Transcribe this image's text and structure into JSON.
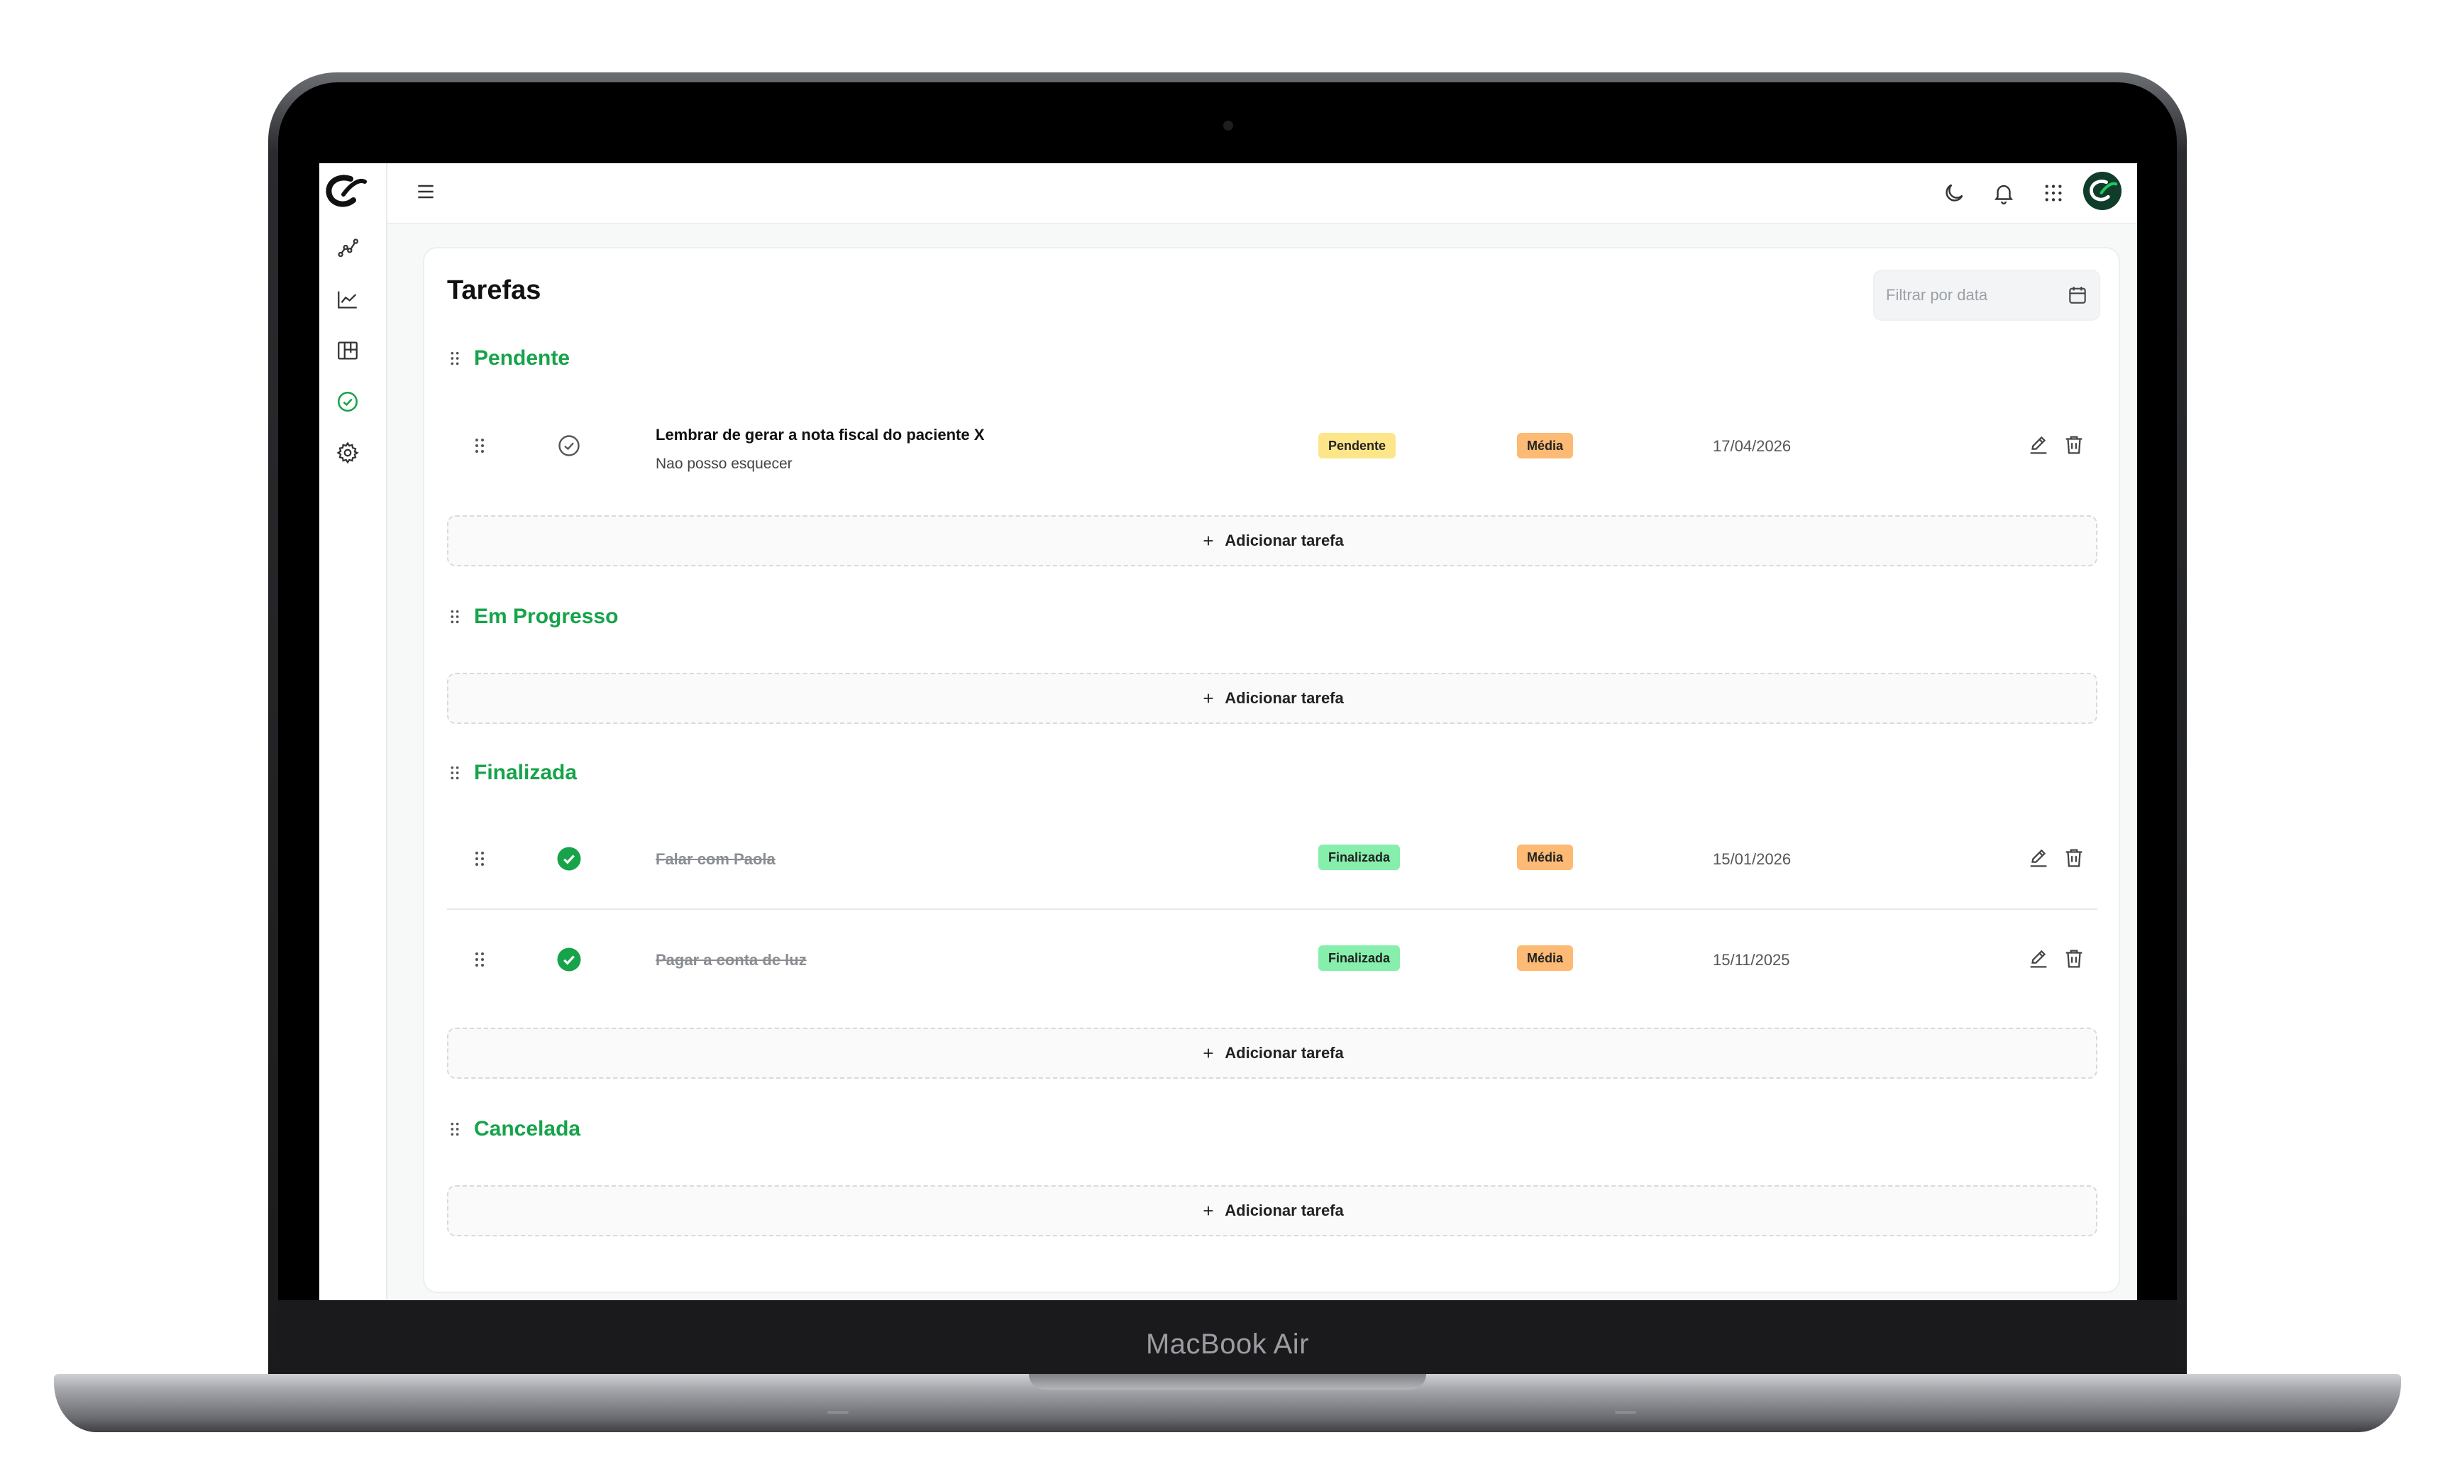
{
  "device": {
    "label": "MacBook Air"
  },
  "header": {
    "icons": [
      "menu-icon",
      "moon-icon",
      "bell-icon",
      "apps-grid-icon"
    ]
  },
  "sidebar": {
    "items": [
      {
        "icon": "analytics-line-icon",
        "active": false
      },
      {
        "icon": "chart-icon",
        "active": false
      },
      {
        "icon": "kanban-icon",
        "active": false
      },
      {
        "icon": "tasks-check-icon",
        "active": true
      },
      {
        "icon": "settings-icon",
        "active": false
      }
    ]
  },
  "page": {
    "title": "Tarefas",
    "date_filter_placeholder": "Filtrar por data",
    "add_task_label": "Adicionar tarefa"
  },
  "sections": [
    {
      "title": "Pendente",
      "tasks": [
        {
          "title": "Lembrar de gerar a nota fiscal do paciente X",
          "description": "Nao posso esquecer",
          "status": "Pendente",
          "priority": "Média",
          "date": "17/04/2026",
          "done": false
        }
      ]
    },
    {
      "title": "Em Progresso",
      "tasks": []
    },
    {
      "title": "Finalizada",
      "tasks": [
        {
          "title": "Falar com Paola",
          "description": "",
          "status": "Finalizada",
          "priority": "Média",
          "date": "15/01/2026",
          "done": true
        },
        {
          "title": "Pagar a conta de luz",
          "description": "",
          "status": "Finalizada",
          "priority": "Média",
          "date": "15/11/2025",
          "done": true
        }
      ]
    },
    {
      "title": "Cancelada",
      "tasks": []
    }
  ],
  "colors": {
    "accent": "#16a34a",
    "status_pending": "#fde68a",
    "status_done": "#86efac",
    "priority_medium": "#fdba74"
  }
}
